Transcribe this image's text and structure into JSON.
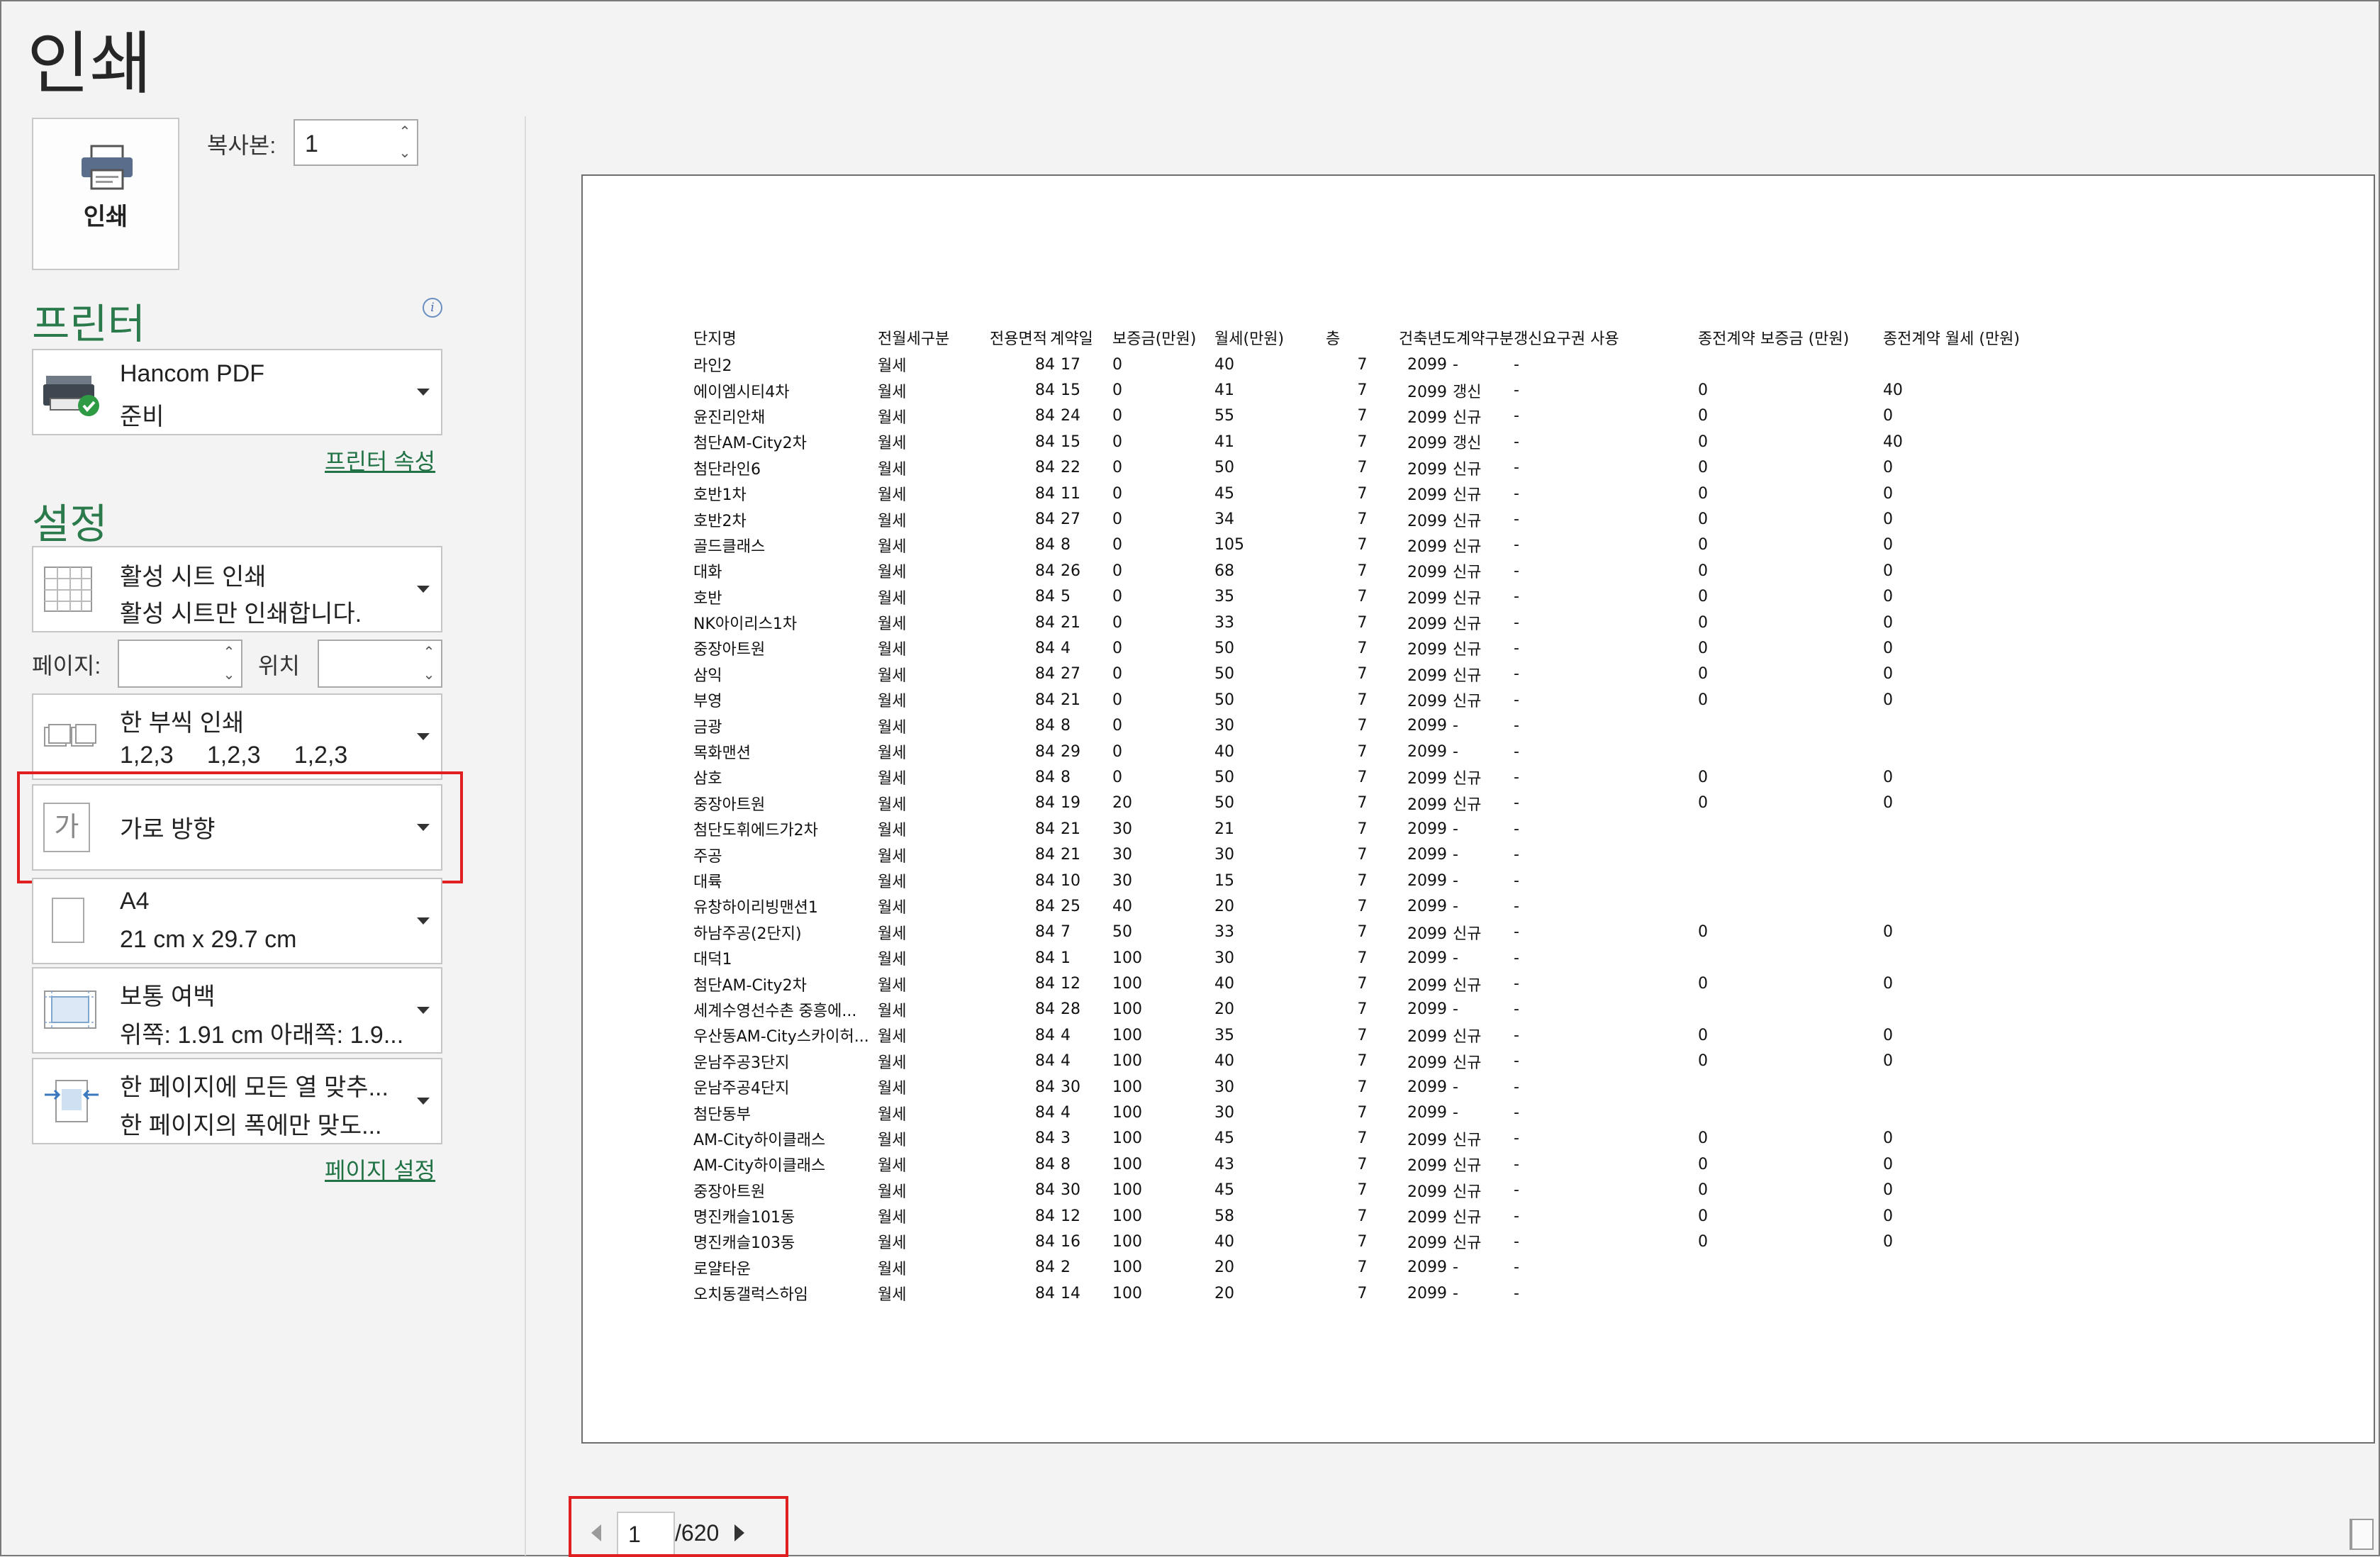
{
  "title": "인쇄",
  "print_button": {
    "label": "인쇄"
  },
  "copies": {
    "label": "복사본:",
    "value": "1"
  },
  "printer": {
    "section_title": "프린터",
    "name": "Hancom PDF",
    "status": "준비",
    "properties_link": "프린터 속성"
  },
  "settings": {
    "section_title": "설정",
    "print_what": {
      "line1": "활성 시트 인쇄",
      "line2": "활성 시트만 인쇄합니다."
    },
    "pages_label": "페이지:",
    "to_label": "위치",
    "collate": {
      "line1": "한 부씩 인쇄",
      "line2": "1,2,3     1,2,3     1,2,3"
    },
    "orientation": {
      "line1": "가로 방향",
      "icon_glyph": "가"
    },
    "paper": {
      "line1": "A4",
      "line2": "21 cm x 29.7 cm"
    },
    "margins": {
      "line1": "보통 여백",
      "line2": "위쪽: 1.91 cm 아래쪽: 1.9..."
    },
    "scaling": {
      "line1": "한 페이지에 모든 열 맞추...",
      "line2": "한 페이지의 폭에만 맞도..."
    },
    "page_setup_link": "페이지 설정"
  },
  "preview": {
    "headers": [
      "단지명",
      "전월세구분",
      "전용면적",
      "계약일",
      "보증금(만원)",
      "월세(만원)",
      "층",
      "건축년도",
      "계약구분",
      "갱신요구권 사용",
      "종전계약 보증금 (만원)",
      "종전계약 월세 (만원)"
    ],
    "rows": [
      [
        "라인2",
        "월세",
        "84",
        "17",
        "0",
        "40",
        "7",
        "2099",
        "-",
        "-",
        "",
        ""
      ],
      [
        "에이엠시티4차",
        "월세",
        "84",
        "15",
        "0",
        "41",
        "7",
        "2099",
        "갱신",
        "-",
        "0",
        "40"
      ],
      [
        "윤진리안채",
        "월세",
        "84",
        "24",
        "0",
        "55",
        "7",
        "2099",
        "신규",
        "-",
        "0",
        "0"
      ],
      [
        "첨단AM-City2차",
        "월세",
        "84",
        "15",
        "0",
        "41",
        "7",
        "2099",
        "갱신",
        "-",
        "0",
        "40"
      ],
      [
        "첨단라인6",
        "월세",
        "84",
        "22",
        "0",
        "50",
        "7",
        "2099",
        "신규",
        "-",
        "0",
        "0"
      ],
      [
        "호반1차",
        "월세",
        "84",
        "11",
        "0",
        "45",
        "7",
        "2099",
        "신규",
        "-",
        "0",
        "0"
      ],
      [
        "호반2차",
        "월세",
        "84",
        "27",
        "0",
        "34",
        "7",
        "2099",
        "신규",
        "-",
        "0",
        "0"
      ],
      [
        "골드클래스",
        "월세",
        "84",
        "8",
        "0",
        "105",
        "7",
        "2099",
        "신규",
        "-",
        "0",
        "0"
      ],
      [
        "대화",
        "월세",
        "84",
        "26",
        "0",
        "68",
        "7",
        "2099",
        "신규",
        "-",
        "0",
        "0"
      ],
      [
        "호반",
        "월세",
        "84",
        "5",
        "0",
        "35",
        "7",
        "2099",
        "신규",
        "-",
        "0",
        "0"
      ],
      [
        "NK아이리스1차",
        "월세",
        "84",
        "21",
        "0",
        "33",
        "7",
        "2099",
        "신규",
        "-",
        "0",
        "0"
      ],
      [
        "중장아트원",
        "월세",
        "84",
        "4",
        "0",
        "50",
        "7",
        "2099",
        "신규",
        "-",
        "0",
        "0"
      ],
      [
        "삼익",
        "월세",
        "84",
        "27",
        "0",
        "50",
        "7",
        "2099",
        "신규",
        "-",
        "0",
        "0"
      ],
      [
        "부영",
        "월세",
        "84",
        "21",
        "0",
        "50",
        "7",
        "2099",
        "신규",
        "-",
        "0",
        "0"
      ],
      [
        "금광",
        "월세",
        "84",
        "8",
        "0",
        "30",
        "7",
        "2099",
        "-",
        "-",
        "",
        ""
      ],
      [
        "목화맨션",
        "월세",
        "84",
        "29",
        "0",
        "40",
        "7",
        "2099",
        "-",
        "-",
        "",
        ""
      ],
      [
        "삼호",
        "월세",
        "84",
        "8",
        "0",
        "50",
        "7",
        "2099",
        "신규",
        "-",
        "0",
        "0"
      ],
      [
        "중장아트원",
        "월세",
        "84",
        "19",
        "20",
        "50",
        "7",
        "2099",
        "신규",
        "-",
        "0",
        "0"
      ],
      [
        "첨단도휘에드가2차",
        "월세",
        "84",
        "21",
        "30",
        "21",
        "7",
        "2099",
        "-",
        "-",
        "",
        ""
      ],
      [
        "주공",
        "월세",
        "84",
        "21",
        "30",
        "30",
        "7",
        "2099",
        "-",
        "-",
        "",
        ""
      ],
      [
        "대륙",
        "월세",
        "84",
        "10",
        "30",
        "15",
        "7",
        "2099",
        "-",
        "-",
        "",
        ""
      ],
      [
        "유창하이리빙맨션1",
        "월세",
        "84",
        "25",
        "40",
        "20",
        "7",
        "2099",
        "-",
        "-",
        "",
        ""
      ],
      [
        "하남주공(2단지)",
        "월세",
        "84",
        "7",
        "50",
        "33",
        "7",
        "2099",
        "신규",
        "-",
        "0",
        "0"
      ],
      [
        "대덕1",
        "월세",
        "84",
        "1",
        "100",
        "30",
        "7",
        "2099",
        "-",
        "-",
        "",
        ""
      ],
      [
        "첨단AM-City2차",
        "월세",
        "84",
        "12",
        "100",
        "40",
        "7",
        "2099",
        "신규",
        "-",
        "0",
        "0"
      ],
      [
        "세계수영선수촌 중흥에...",
        "월세",
        "84",
        "28",
        "100",
        "20",
        "7",
        "2099",
        "-",
        "-",
        "",
        ""
      ],
      [
        "우산동AM-City스카이허...",
        "월세",
        "84",
        "4",
        "100",
        "35",
        "7",
        "2099",
        "신규",
        "-",
        "0",
        "0"
      ],
      [
        "운남주공3단지",
        "월세",
        "84",
        "4",
        "100",
        "40",
        "7",
        "2099",
        "신규",
        "-",
        "0",
        "0"
      ],
      [
        "운남주공4단지",
        "월세",
        "84",
        "30",
        "100",
        "30",
        "7",
        "2099",
        "-",
        "-",
        "",
        ""
      ],
      [
        "첨단동부",
        "월세",
        "84",
        "4",
        "100",
        "30",
        "7",
        "2099",
        "-",
        "-",
        "",
        ""
      ],
      [
        "AM-City하이클래스",
        "월세",
        "84",
        "3",
        "100",
        "45",
        "7",
        "2099",
        "신규",
        "-",
        "0",
        "0"
      ],
      [
        "AM-City하이클래스",
        "월세",
        "84",
        "8",
        "100",
        "43",
        "7",
        "2099",
        "신규",
        "-",
        "0",
        "0"
      ],
      [
        "중장아트원",
        "월세",
        "84",
        "30",
        "100",
        "45",
        "7",
        "2099",
        "신규",
        "-",
        "0",
        "0"
      ],
      [
        "명진캐슬101동",
        "월세",
        "84",
        "12",
        "100",
        "58",
        "7",
        "2099",
        "신규",
        "-",
        "0",
        "0"
      ],
      [
        "명진캐슬103동",
        "월세",
        "84",
        "16",
        "100",
        "40",
        "7",
        "2099",
        "신규",
        "-",
        "0",
        "0"
      ],
      [
        "로얄타운",
        "월세",
        "84",
        "2",
        "100",
        "20",
        "7",
        "2099",
        "-",
        "-",
        "",
        ""
      ],
      [
        "오치동갤럭스하임",
        "월세",
        "84",
        "14",
        "100",
        "20",
        "7",
        "2099",
        "-",
        "-",
        "",
        ""
      ]
    ]
  },
  "pager": {
    "current": "1",
    "total": "/620"
  },
  "colors": {
    "accent": "#217346",
    "highlight": "#e02020"
  }
}
